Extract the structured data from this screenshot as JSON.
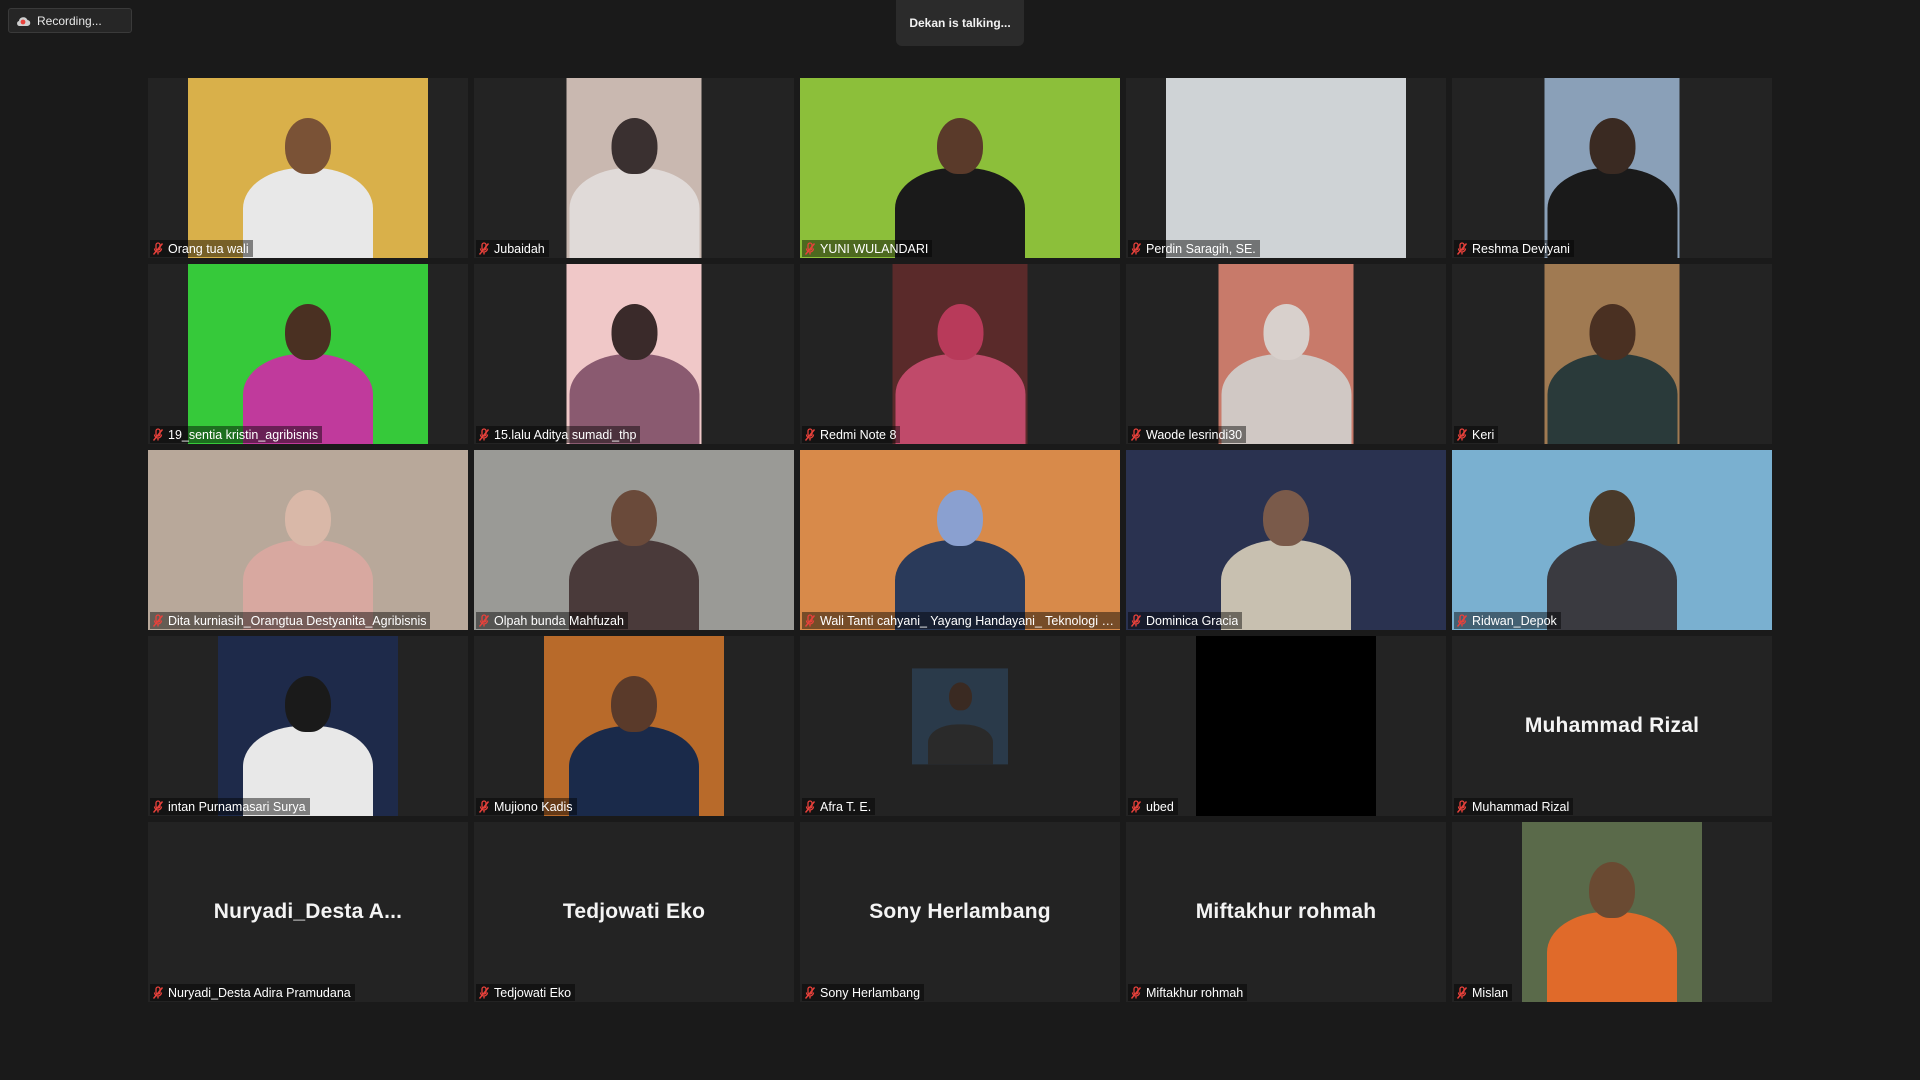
{
  "recording": {
    "label": "Recording..."
  },
  "speaker": {
    "label": "Dekan is talking..."
  },
  "colors": {
    "background": "#1a1a1a",
    "tile": "#232323",
    "muted_icon": "#e8413b"
  },
  "participants": [
    {
      "name": "Orang tua wali",
      "video": true,
      "bg": "#d9b04a",
      "head": "#7a5236",
      "body": "#e8e8e8",
      "w": 240
    },
    {
      "name": "Jubaidah",
      "video": true,
      "bg": "#c9b8b0",
      "head": "#3a3030",
      "body": "#e0dad8",
      "w": 135
    },
    {
      "name": "YUNI WULANDARI",
      "video": true,
      "bg": "#8cbf3a",
      "head": "#5a3a2a",
      "body": "#1a1a1a",
      "w": 320
    },
    {
      "name": "Perdin Saragih, SE.",
      "video": true,
      "bg": "#cfd3d6",
      "head": "",
      "body": "",
      "w": 240
    },
    {
      "name": "Reshma Deviyani",
      "video": true,
      "bg": "#8aa0b8",
      "head": "#3a2a22",
      "body": "#1a1a1a",
      "w": 135
    },
    {
      "name": "19_sentia kristin_agribisnis",
      "video": true,
      "bg": "#36c93a",
      "head": "#4a3022",
      "body": "#c03a9c",
      "w": 240
    },
    {
      "name": "15.lalu Aditya sumadi_thp",
      "video": true,
      "bg": "#f0c8c8",
      "head": "#3a2a2a",
      "body": "#8a5a70",
      "w": 135
    },
    {
      "name": "Redmi Note 8",
      "video": true,
      "bg": "#5a2a2a",
      "head": "#b83a5a",
      "body": "#c04a6a",
      "w": 135
    },
    {
      "name": "Waode lesrindi30",
      "video": true,
      "bg": "#c87a6a",
      "head": "#d8d0cc",
      "body": "#d0c8c4",
      "w": 135
    },
    {
      "name": "Keri",
      "video": true,
      "bg": "#a07a52",
      "head": "#4a3022",
      "body": "#2a3a3a",
      "w": 135
    },
    {
      "name": "Dita kurniasih_Orangtua Destyanita_Agribisnis",
      "video": true,
      "bg": "#b8a89a",
      "head": "#d9b8a8",
      "body": "#d8a8a0",
      "w": 320
    },
    {
      "name": "Olpah bunda Mahfuzah",
      "video": true,
      "bg": "#9a9a96",
      "head": "#6a4a3a",
      "body": "#4a3a3a",
      "w": 320
    },
    {
      "name": "Wali Tanti cahyani_ Yayang Handayani_ Teknologi Hasil Pertanian",
      "video": true,
      "bg": "#d88a4a",
      "head": "#8aa0d0",
      "body": "#2a3a5a",
      "w": 320
    },
    {
      "name": "Dominica Gracia",
      "video": true,
      "bg": "#2a3250",
      "head": "#7a5a4a",
      "body": "#c8c0b0",
      "w": 320
    },
    {
      "name": "Ridwan_Depok",
      "video": true,
      "bg": "#7ab0d0",
      "head": "#4a3a2a",
      "body": "#3a3a40",
      "w": 320
    },
    {
      "name": "intan Purnamasari Surya",
      "video": true,
      "bg": "#1e2a4a",
      "head": "#1a1a1a",
      "body": "#e8e8e8",
      "w": 180
    },
    {
      "name": "Mujiono Kadis",
      "video": true,
      "bg": "#b86a2a",
      "head": "#5a3a2a",
      "body": "#1a2a4a",
      "w": 180
    },
    {
      "name": "Afra T. E.",
      "video": true,
      "bg": "#2a3a4a",
      "head": "#3a2a22",
      "body": "#2a2a2a",
      "w": 96,
      "small": true
    },
    {
      "name": "ubed",
      "video": true,
      "bg": "#000000",
      "head": "",
      "body": "",
      "w": 180
    },
    {
      "name": "Muhammad Rizal",
      "video": false,
      "display": "Muhammad Rizal"
    },
    {
      "name": "Nuryadi_Desta Adira Pramudana",
      "video": false,
      "display": "Nuryadi_Desta  A..."
    },
    {
      "name": "Tedjowati Eko",
      "video": false,
      "display": "Tedjowati Eko"
    },
    {
      "name": "Sony Herlambang",
      "video": false,
      "display": "Sony Herlambang"
    },
    {
      "name": "Miftakhur rohmah",
      "video": false,
      "display": "Miftakhur rohmah"
    },
    {
      "name": "Mislan",
      "video": true,
      "bg": "#5a6a4a",
      "head": "#6a4a32",
      "body": "#e06a2a",
      "w": 180
    }
  ]
}
